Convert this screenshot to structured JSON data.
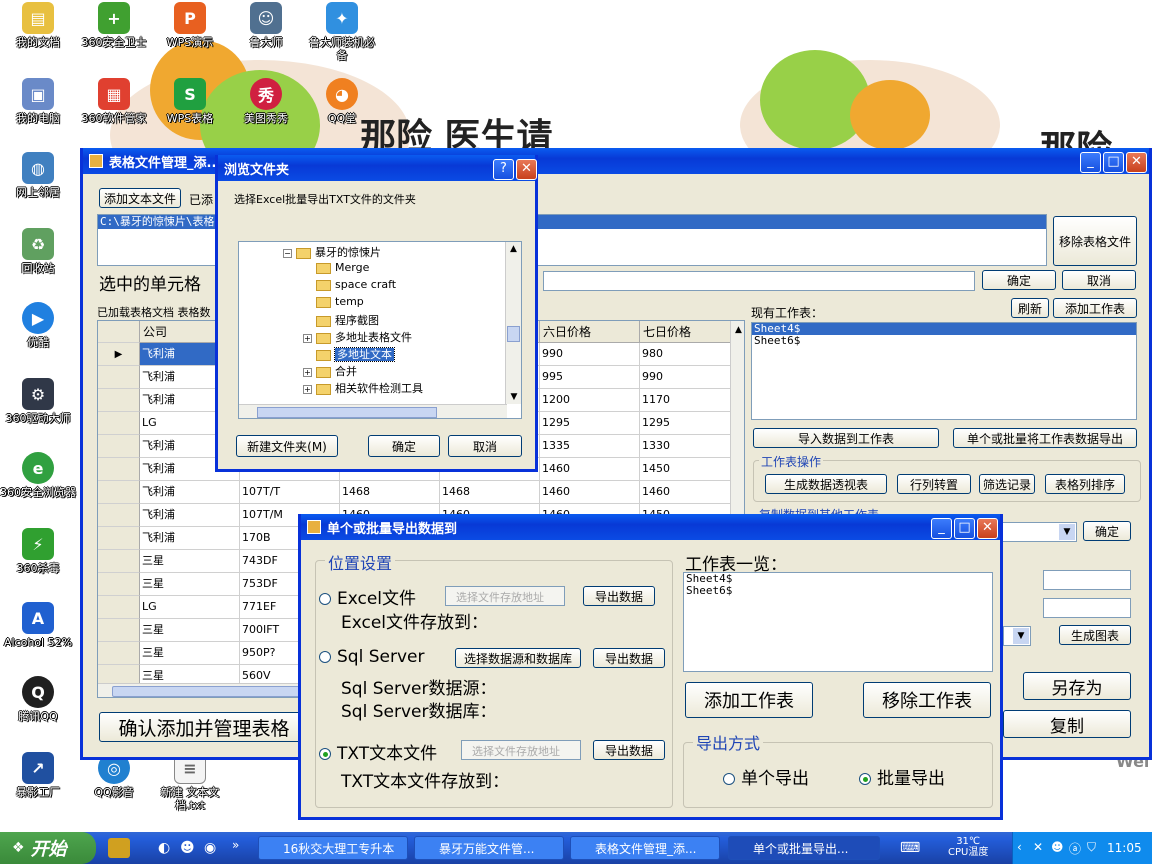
{
  "desktop": {
    "bg_text_1": "那险  医生请",
    "bg_text_2": "那险",
    "bg_text_3": "Wel",
    "icons": [
      {
        "label": "我的文档"
      },
      {
        "label": "360安全卫士"
      },
      {
        "label": "WPS演示"
      },
      {
        "label": "鲁大师"
      },
      {
        "label": "鲁大师装机必备"
      },
      {
        "label": "我的电脑"
      },
      {
        "label": "360软件管家"
      },
      {
        "label": "WPS表格"
      },
      {
        "label": "美图秀秀"
      },
      {
        "label": "QQ堂"
      },
      {
        "label": "网上邻居"
      },
      {
        "label": "回收站"
      },
      {
        "label": "优酷"
      },
      {
        "label": "360驱动大师"
      },
      {
        "label": "360安全浏览器"
      },
      {
        "label": "360杀毒"
      },
      {
        "label": "Alcohol 52%"
      },
      {
        "label": "腾讯QQ"
      },
      {
        "label": "暴影工厂"
      },
      {
        "label": "QQ影音"
      },
      {
        "label": "新建 文本文档.txt"
      }
    ]
  },
  "main_window": {
    "title": "表格文件管理_添...",
    "add_text_file": "添加文本文件",
    "added_label": "已添",
    "file_path": "C:\\暴牙的惊悚片\\表格",
    "remove_table_file": "移除表格文件",
    "selected_cell_label": "选中的单元格",
    "confirm": "确定",
    "cancel": "取消",
    "loaded_docs_label": "已加载表格文档  表格数",
    "refresh": "刷新",
    "add_sheet": "添加工作表",
    "existing_sheets_label": "现有工作表：",
    "sheets": [
      "Sheet4$",
      "Sheet6$"
    ],
    "import_data": "导入数据到工作表",
    "export_sheets": "单个或批量将工作表数据导出",
    "sheet_ops_label": "工作表操作",
    "pivot": "生成数据透视表",
    "transpose": "行列转置",
    "filter": "筛选记录",
    "sort_cols": "表格列排序",
    "copy_data_label": "复制数据到其他工作表",
    "confirm2": "确定",
    "gen_chart": "生成图表",
    "save_as": "另存为",
    "copy": "复制",
    "confirm_manage": "确认添加并管理表格",
    "grid": {
      "headers": [
        "公司",
        "",
        "",
        "",
        "六日价格",
        "七日价格"
      ],
      "rows": [
        [
          "飞利浦",
          "",
          "",
          "",
          "990",
          "980"
        ],
        [
          "飞利浦",
          "",
          "",
          "",
          "995",
          "990"
        ],
        [
          "飞利浦",
          "",
          "",
          "",
          "1200",
          "1170"
        ],
        [
          "LG",
          "",
          "",
          "",
          "1295",
          "1295"
        ],
        [
          "飞利浦",
          "",
          "",
          "",
          "1335",
          "1330"
        ],
        [
          "飞利浦",
          "",
          "",
          "",
          "1460",
          "1450"
        ],
        [
          "飞利浦",
          "107T/T",
          "1468",
          "1468",
          "1460",
          "1460"
        ],
        [
          "飞利浦",
          "107T/M",
          "1460",
          "1460",
          "1460",
          "1450"
        ],
        [
          "飞利浦",
          "170B",
          "",
          "",
          "",
          ""
        ],
        [
          "三星",
          "743DF",
          "",
          "",
          "",
          ""
        ],
        [
          "三星",
          "753DF",
          "",
          "",
          "",
          ""
        ],
        [
          "LG",
          "771EF",
          "",
          "",
          "",
          ""
        ],
        [
          "三星",
          "700IFT",
          "",
          "",
          "",
          ""
        ],
        [
          "三星",
          "950P?",
          "",
          "",
          "",
          ""
        ],
        [
          "三星",
          "560V",
          "",
          "",
          "",
          ""
        ]
      ]
    }
  },
  "browse_dialog": {
    "title": "浏览文件夹",
    "prompt": "选择Excel批量导出TXT文件的文件夹",
    "tree": [
      {
        "label": "暴牙的惊悚片",
        "expander": "−"
      },
      {
        "label": "Merge",
        "expander": ""
      },
      {
        "label": "space craft",
        "expander": ""
      },
      {
        "label": "temp",
        "expander": ""
      },
      {
        "label": "程序截图",
        "expander": ""
      },
      {
        "label": "多地址表格文件",
        "expander": "+"
      },
      {
        "label": "多地址文本",
        "expander": ""
      },
      {
        "label": "合并",
        "expander": "+"
      },
      {
        "label": "相关软件检测工具",
        "expander": "+"
      }
    ],
    "new_folder": "新建文件夹(M)",
    "ok": "确定",
    "cancel": "取消"
  },
  "export_dialog": {
    "title": "单个或批量导出数据到",
    "position_settings": "位置设置",
    "excel_label": "Excel文件",
    "excel_placeholder": "选择文件存放地址",
    "export": "导出数据",
    "excel_store": "Excel文件存放到：",
    "sql_label": "Sql Server",
    "choose_source": "选择数据源和数据库",
    "sql_source": "Sql Server数据源：",
    "sql_db": "Sql Server数据库：",
    "txt_label": "TXT文本文件",
    "txt_placeholder": "选择文件存放地址",
    "txt_store": "TXT文本文件存放到：",
    "sheets_label": "工作表一览：",
    "sheets": [
      "Sheet4$",
      "Sheet6$"
    ],
    "add_sheet": "添加工作表",
    "remove_sheet": "移除工作表",
    "export_mode": "导出方式",
    "single": "单个导出",
    "batch": "批量导出"
  },
  "taskbar": {
    "start": "开始",
    "tasks": [
      {
        "label": "16秋交大理工专升本"
      },
      {
        "label": "暴牙万能文件管..."
      },
      {
        "label": "表格文件管理_添..."
      },
      {
        "label": "单个或批量导出..."
      }
    ],
    "temp": "31℃",
    "cpu": "CPU温度",
    "time": "11:05"
  },
  "colors": {
    "xp_blue": "#0831d9",
    "taskbar": "#245edb",
    "start_green": "#3a8a3a",
    "selection": "#316ac5"
  }
}
